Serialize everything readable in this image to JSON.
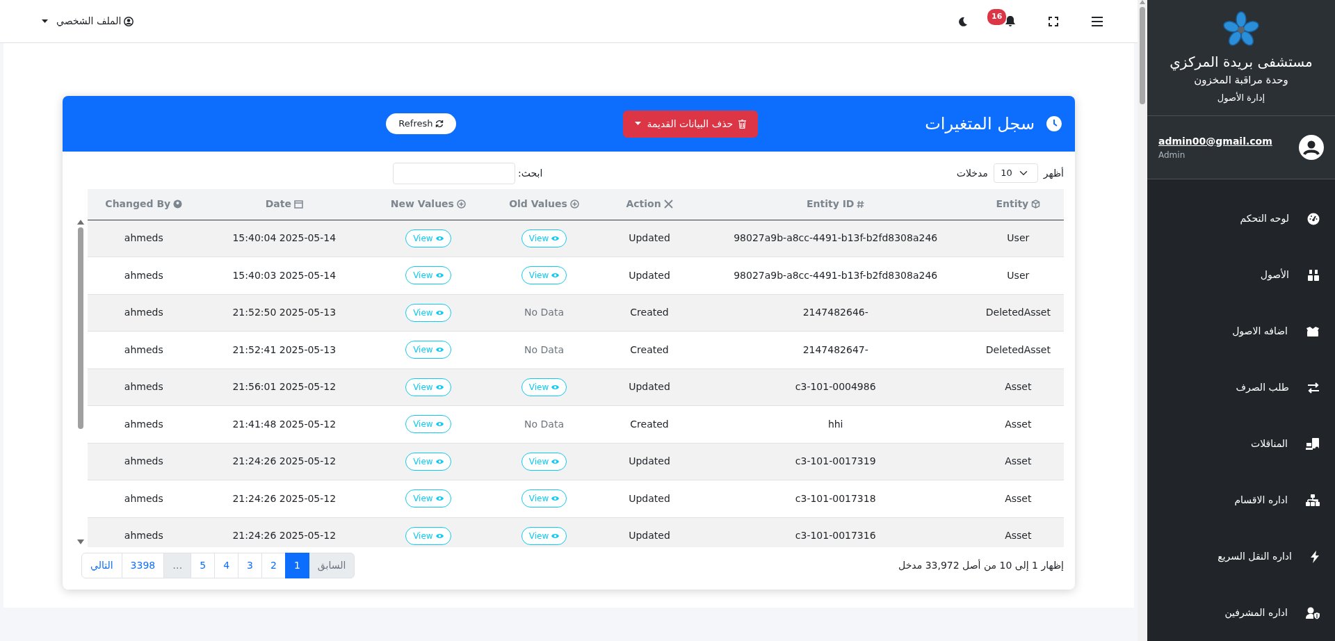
{
  "topbar": {
    "profile_label": "الملف الشخصي",
    "notification_count": "16"
  },
  "sidebar": {
    "title": "مستشفى بريدة المركزي",
    "subtitle": "وحدة مراقبة المخزون",
    "section": "إدارة الأصول",
    "user": {
      "email": "admin00@gmail.com",
      "role": "Admin"
    },
    "items": [
      {
        "label": "لوحه التحكم"
      },
      {
        "label": "الأصول"
      },
      {
        "label": "اضافه الاصول"
      },
      {
        "label": "طلب الصرف"
      },
      {
        "label": "المناقلات"
      },
      {
        "label": "اداره الاقسام"
      },
      {
        "label": "اداره النقل السريع"
      },
      {
        "label": "اداره المشرفين"
      }
    ]
  },
  "card": {
    "title": "سجل المتغيرات",
    "delete_button": "حذف البيانات القديمة",
    "refresh_button": "Refresh",
    "length": {
      "prefix": "أظهر",
      "value": "10",
      "suffix": "مدخلات"
    },
    "search_label": "ابحث:",
    "table": {
      "columns": [
        "Changed By",
        "Date",
        "New Values",
        "Old Values",
        "Action",
        "Entity ID",
        "Entity"
      ],
      "rows": [
        [
          {
            "kind": "text",
            "label": "ahmeds"
          },
          {
            "kind": "text",
            "label": "15:40:04 2025-05-14"
          },
          {
            "kind": "button",
            "label": "View"
          },
          {
            "kind": "button",
            "label": "View"
          },
          {
            "kind": "text",
            "label": "Updated"
          },
          {
            "kind": "text",
            "label": "98027a9b-a8cc-4491-b13f-b2fd8308a246"
          },
          {
            "kind": "text",
            "label": "User"
          }
        ],
        [
          {
            "kind": "text",
            "label": "ahmeds"
          },
          {
            "kind": "text",
            "label": "15:40:03 2025-05-14"
          },
          {
            "kind": "button",
            "label": "View"
          },
          {
            "kind": "button",
            "label": "View"
          },
          {
            "kind": "text",
            "label": "Updated"
          },
          {
            "kind": "text",
            "label": "98027a9b-a8cc-4491-b13f-b2fd8308a246"
          },
          {
            "kind": "text",
            "label": "User"
          }
        ],
        [
          {
            "kind": "text",
            "label": "ahmeds"
          },
          {
            "kind": "text",
            "label": "21:52:50 2025-05-13"
          },
          {
            "kind": "button",
            "label": "View"
          },
          {
            "kind": "empty",
            "label": "No Data"
          },
          {
            "kind": "text",
            "label": "Created"
          },
          {
            "kind": "text",
            "label": "2147482646-"
          },
          {
            "kind": "text",
            "label": "DeletedAsset"
          }
        ],
        [
          {
            "kind": "text",
            "label": "ahmeds"
          },
          {
            "kind": "text",
            "label": "21:52:41 2025-05-13"
          },
          {
            "kind": "button",
            "label": "View"
          },
          {
            "kind": "empty",
            "label": "No Data"
          },
          {
            "kind": "text",
            "label": "Created"
          },
          {
            "kind": "text",
            "label": "2147482647-"
          },
          {
            "kind": "text",
            "label": "DeletedAsset"
          }
        ],
        [
          {
            "kind": "text",
            "label": "ahmeds"
          },
          {
            "kind": "text",
            "label": "21:56:01 2025-05-12"
          },
          {
            "kind": "button",
            "label": "View"
          },
          {
            "kind": "button",
            "label": "View"
          },
          {
            "kind": "text",
            "label": "Updated"
          },
          {
            "kind": "text",
            "label": "c3-101-0004986"
          },
          {
            "kind": "text",
            "label": "Asset"
          }
        ],
        [
          {
            "kind": "text",
            "label": "ahmeds"
          },
          {
            "kind": "text",
            "label": "21:41:48 2025-05-12"
          },
          {
            "kind": "button",
            "label": "View"
          },
          {
            "kind": "empty",
            "label": "No Data"
          },
          {
            "kind": "text",
            "label": "Created"
          },
          {
            "kind": "text",
            "label": "hhi"
          },
          {
            "kind": "text",
            "label": "Asset"
          }
        ],
        [
          {
            "kind": "text",
            "label": "ahmeds"
          },
          {
            "kind": "text",
            "label": "21:24:26 2025-05-12"
          },
          {
            "kind": "button",
            "label": "View"
          },
          {
            "kind": "button",
            "label": "View"
          },
          {
            "kind": "text",
            "label": "Updated"
          },
          {
            "kind": "text",
            "label": "c3-101-0017319"
          },
          {
            "kind": "text",
            "label": "Asset"
          }
        ],
        [
          {
            "kind": "text",
            "label": "ahmeds"
          },
          {
            "kind": "text",
            "label": "21:24:26 2025-05-12"
          },
          {
            "kind": "button",
            "label": "View"
          },
          {
            "kind": "button",
            "label": "View"
          },
          {
            "kind": "text",
            "label": "Updated"
          },
          {
            "kind": "text",
            "label": "c3-101-0017318"
          },
          {
            "kind": "text",
            "label": "Asset"
          }
        ],
        [
          {
            "kind": "text",
            "label": "ahmeds"
          },
          {
            "kind": "text",
            "label": "21:24:26 2025-05-12"
          },
          {
            "kind": "button",
            "label": "View"
          },
          {
            "kind": "button",
            "label": "View"
          },
          {
            "kind": "text",
            "label": "Updated"
          },
          {
            "kind": "text",
            "label": "c3-101-0017316"
          },
          {
            "kind": "text",
            "label": "Asset"
          }
        ]
      ]
    },
    "info": "إظهار 1 إلى 10 من أصل 33,972 مدخل",
    "pagination": [
      {
        "label": "التالي",
        "selected": false,
        "disabled": false
      },
      {
        "label": "3398",
        "selected": false,
        "disabled": false
      },
      {
        "label": "…",
        "selected": false,
        "disabled": true
      },
      {
        "label": "5",
        "selected": false,
        "disabled": false
      },
      {
        "label": "4",
        "selected": false,
        "disabled": false
      },
      {
        "label": "3",
        "selected": false,
        "disabled": false
      },
      {
        "label": "2",
        "selected": false,
        "disabled": false
      },
      {
        "label": "1",
        "selected": true,
        "disabled": false
      },
      {
        "label": "السابق",
        "selected": false,
        "disabled": true
      }
    ]
  }
}
